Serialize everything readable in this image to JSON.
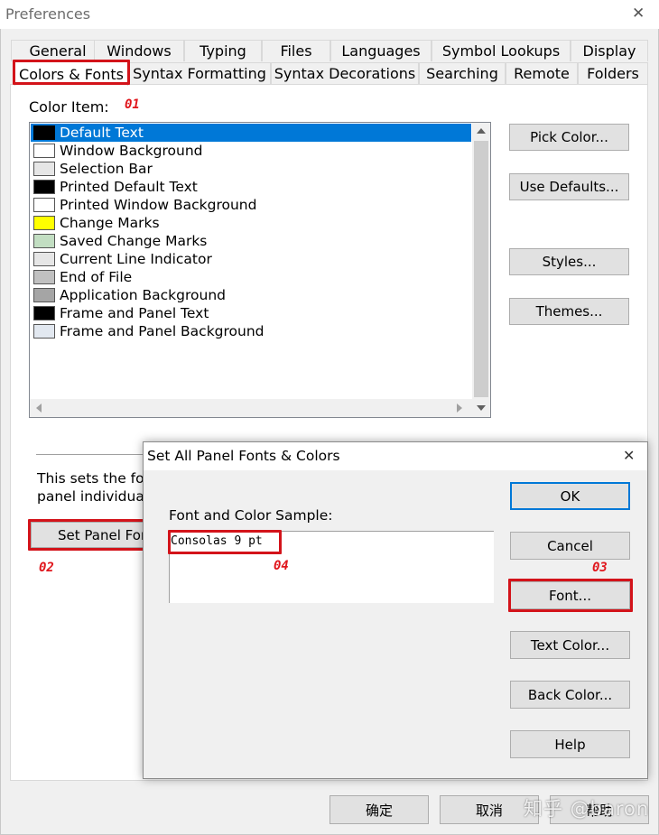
{
  "window": {
    "title": "Preferences",
    "close_glyph": "✕"
  },
  "tabs_row1": [
    "General",
    "Windows",
    "Typing",
    "Files",
    "Languages",
    "Symbol Lookups",
    "Display"
  ],
  "tabs_row2": [
    "Colors & Fonts",
    "Syntax Formatting",
    "Syntax Decorations",
    "Searching",
    "Remote",
    "Folders"
  ],
  "color_item_label": "Color Item:",
  "color_items": [
    {
      "label": "Default Text",
      "swatch": "#000000",
      "selected": true
    },
    {
      "label": "Window Background",
      "swatch": "#ffffff"
    },
    {
      "label": "Selection Bar",
      "swatch": "#e6e6e6"
    },
    {
      "label": "Printed Default Text",
      "swatch": "#000000"
    },
    {
      "label": "Printed Window Background",
      "swatch": "#ffffff"
    },
    {
      "label": "Change Marks",
      "swatch": "#ffff00"
    },
    {
      "label": "Saved Change Marks",
      "swatch": "#c2dec2"
    },
    {
      "label": "Current Line Indicator",
      "swatch": "#e6e6e6"
    },
    {
      "label": "End of File",
      "swatch": "#c0c0c0"
    },
    {
      "label": "Application Background",
      "swatch": "#a5a5a5"
    },
    {
      "label": "Frame and Panel Text",
      "swatch": "#000000"
    },
    {
      "label": "Frame and Panel Background",
      "swatch": "#e2e8f0"
    }
  ],
  "side_buttons": {
    "pick_color": "Pick Color...",
    "use_defaults": "Use Defaults...",
    "styles": "Styles...",
    "themes": "Themes..."
  },
  "panel_info": {
    "line1": "This sets the fon",
    "line2": "panel individuall",
    "set_panel_button": "Set Panel For"
  },
  "bottom_buttons": {
    "ok": "确定",
    "cancel": "取消",
    "apply": "帮助"
  },
  "watermark": "知乎 @baron",
  "annotations": [
    "01",
    "02",
    "03",
    "04"
  ],
  "dialog": {
    "title": "Set All Panel Fonts & Colors",
    "sample_label": "Font and Color Sample:",
    "sample_text": "Consolas 9 pt",
    "buttons": {
      "ok": "OK",
      "cancel": "Cancel",
      "font": "Font...",
      "text_color": "Text Color...",
      "back_color": "Back Color...",
      "help": "Help"
    }
  },
  "colors": {
    "accent": "#0078d7",
    "annotation_red": "#d3131a"
  }
}
